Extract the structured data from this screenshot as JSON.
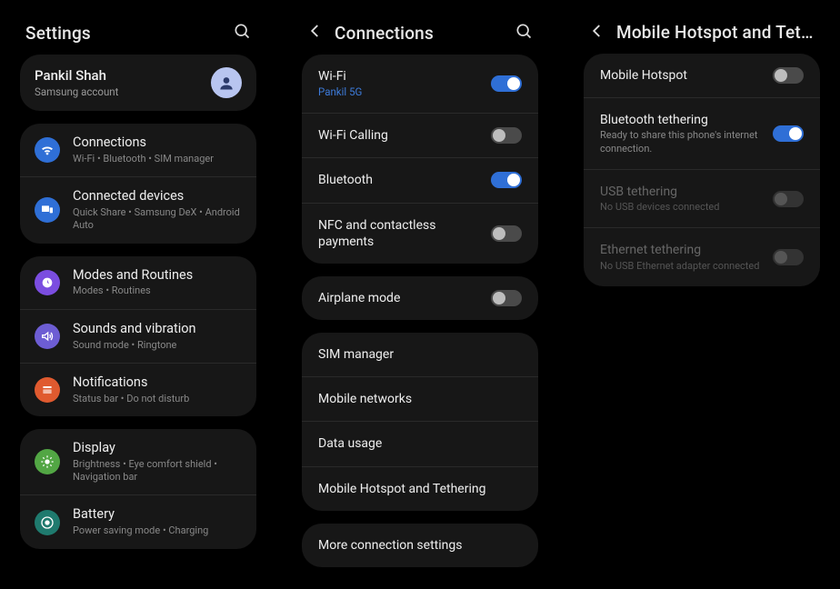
{
  "phone1": {
    "title": "Settings",
    "account": {
      "name": "Pankil Shah",
      "sub": "Samsung account"
    },
    "groups": [
      [
        {
          "icon": "wifi",
          "color": "ic-blue",
          "title": "Connections",
          "sub": "Wi-Fi  •  Bluetooth  •  SIM manager"
        },
        {
          "icon": "devices",
          "color": "ic-blue2",
          "title": "Connected devices",
          "sub": "Quick Share  •  Samsung DeX  •  Android Auto"
        }
      ],
      [
        {
          "icon": "routines",
          "color": "ic-purple",
          "title": "Modes and Routines",
          "sub": "Modes  •  Routines"
        },
        {
          "icon": "sound",
          "color": "ic-violet",
          "title": "Sounds and vibration",
          "sub": "Sound mode  •  Ringtone"
        },
        {
          "icon": "notif",
          "color": "ic-orange",
          "title": "Notifications",
          "sub": "Status bar  •  Do not disturb"
        }
      ],
      [
        {
          "icon": "display",
          "color": "ic-green",
          "title": "Display",
          "sub": "Brightness  •  Eye comfort shield  •  Navigation bar"
        },
        {
          "icon": "battery",
          "color": "ic-teal",
          "title": "Battery",
          "sub": "Power saving mode  •  Charging"
        }
      ]
    ]
  },
  "phone2": {
    "title": "Connections",
    "groups": [
      [
        {
          "title": "Wi-Fi",
          "sub": "Pankil 5G",
          "subClass": "blue",
          "toggle": "on"
        },
        {
          "title": "Wi-Fi Calling",
          "toggle": "off"
        },
        {
          "title": "Bluetooth",
          "toggle": "on"
        },
        {
          "title": "NFC and contactless payments",
          "toggle": "off"
        }
      ],
      [
        {
          "title": "Airplane mode",
          "toggle": "off"
        }
      ],
      [
        {
          "title": "SIM manager"
        },
        {
          "title": "Mobile networks"
        },
        {
          "title": "Data usage"
        },
        {
          "title": "Mobile Hotspot and Tethering"
        }
      ],
      [
        {
          "title": "More connection settings"
        }
      ]
    ]
  },
  "phone3": {
    "title": "Mobile Hotspot and Tether...",
    "groups": [
      [
        {
          "title": "Mobile Hotspot",
          "toggle": "off"
        },
        {
          "title": "Bluetooth tethering",
          "sub": "Ready to share this phone's internet connection.",
          "toggle": "on"
        },
        {
          "title": "USB tethering",
          "sub": "No USB devices connected",
          "toggle": "disabled",
          "disabled": true
        },
        {
          "title": "Ethernet tethering",
          "sub": "No USB Ethernet adapter connected",
          "toggle": "disabled",
          "disabled": true
        }
      ]
    ]
  }
}
